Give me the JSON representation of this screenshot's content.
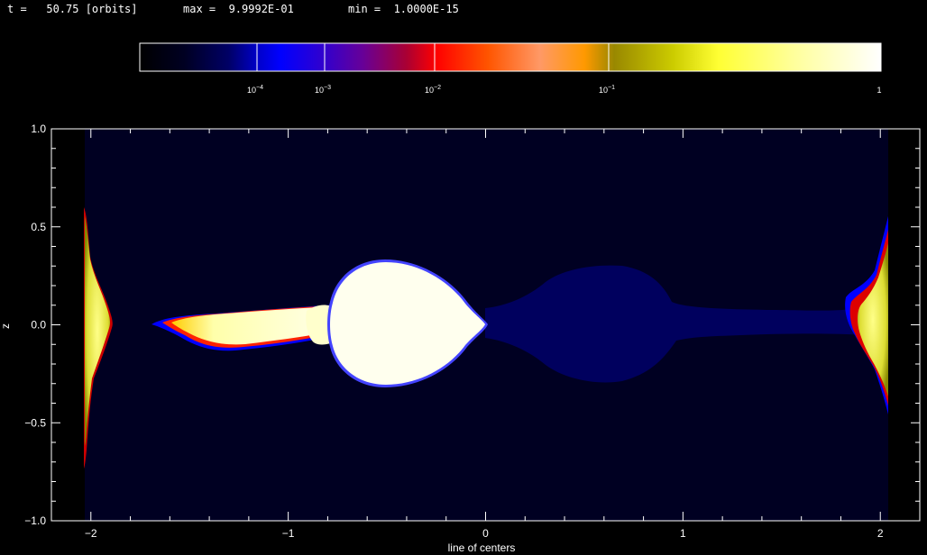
{
  "header": {
    "time_label": "t =   50.75 [orbits]",
    "max_label": "max =  9.9992E-01",
    "min_label": "min =  1.0000E-15"
  },
  "colorbar": {
    "stops": [
      {
        "value": 0.0,
        "color": "#000000"
      },
      {
        "value": 0.15,
        "color": "#000033"
      },
      {
        "value": 0.26,
        "color": "#000099"
      },
      {
        "value": 0.18,
        "color": "#000066"
      },
      {
        "value": 0.36,
        "color": "#0000ff"
      },
      {
        "value": 0.45,
        "color": "#6600aa"
      },
      {
        "value": 0.5,
        "color": "#990055"
      },
      {
        "value": 0.58,
        "color": "#cc0000"
      },
      {
        "value": 0.62,
        "color": "#ff0000"
      },
      {
        "value": 0.72,
        "color": "#ff6600"
      },
      {
        "value": 0.8,
        "color": "#ff9933"
      },
      {
        "value": 0.86,
        "color": "#cc9900"
      },
      {
        "value": 0.92,
        "color": "#999900"
      },
      {
        "value": 1.0,
        "color": "#ffff33"
      }
    ],
    "tail_colors": [
      "#ffff66",
      "#ffffcc",
      "#ffffff"
    ],
    "tick_labels": [
      {
        "base": "10",
        "exp": "−4",
        "value": -4
      },
      {
        "base": "10",
        "exp": "−3",
        "value": -3
      },
      {
        "base": "10",
        "exp": "−2",
        "value": -2
      },
      {
        "base": "10",
        "exp": "−1",
        "value": -1
      },
      {
        "base": "1",
        "exp": "",
        "value": 0
      }
    ],
    "log_min": -5.0,
    "log_max": 0.0
  },
  "chart_data": {
    "type": "heatmap",
    "xlabel": "line of centers",
    "ylabel": "z",
    "xlim": [
      -2.2,
      2.2
    ],
    "ylim": [
      -1.0,
      1.0
    ],
    "x_ticks": [
      -2,
      -1,
      0,
      1,
      2
    ],
    "x_tick_labels": [
      "−2",
      "−1",
      "0",
      "1",
      "2"
    ],
    "y_ticks": [
      -1.0,
      -0.5,
      0.0,
      0.5,
      1.0
    ],
    "y_tick_labels": [
      "−1.0",
      "−0.5",
      "0.0",
      "0.5",
      "1.0"
    ],
    "background_color": "#000022",
    "field": "density",
    "features": [
      {
        "name": "left-star-envelope",
        "center_x": -0.43,
        "center_z": 0.0,
        "radius_x": 0.38,
        "radius_z": 0.31,
        "color": "#ffffee"
      },
      {
        "name": "left-stream",
        "x_from": -1.65,
        "x_to": -0.8,
        "z_center": 0.0,
        "color": "#ffffcc"
      },
      {
        "name": "right-lobe",
        "x_from": 0.0,
        "x_to": 1.95,
        "color": "#000066"
      },
      {
        "name": "left-edge-material",
        "x": -2.0,
        "z_from": -0.55,
        "z_to": 0.6,
        "color": "#ffff66"
      },
      {
        "name": "right-edge-material",
        "x": 2.0,
        "z_from": -0.35,
        "z_to": 0.4,
        "color": "#ffff66"
      }
    ]
  }
}
